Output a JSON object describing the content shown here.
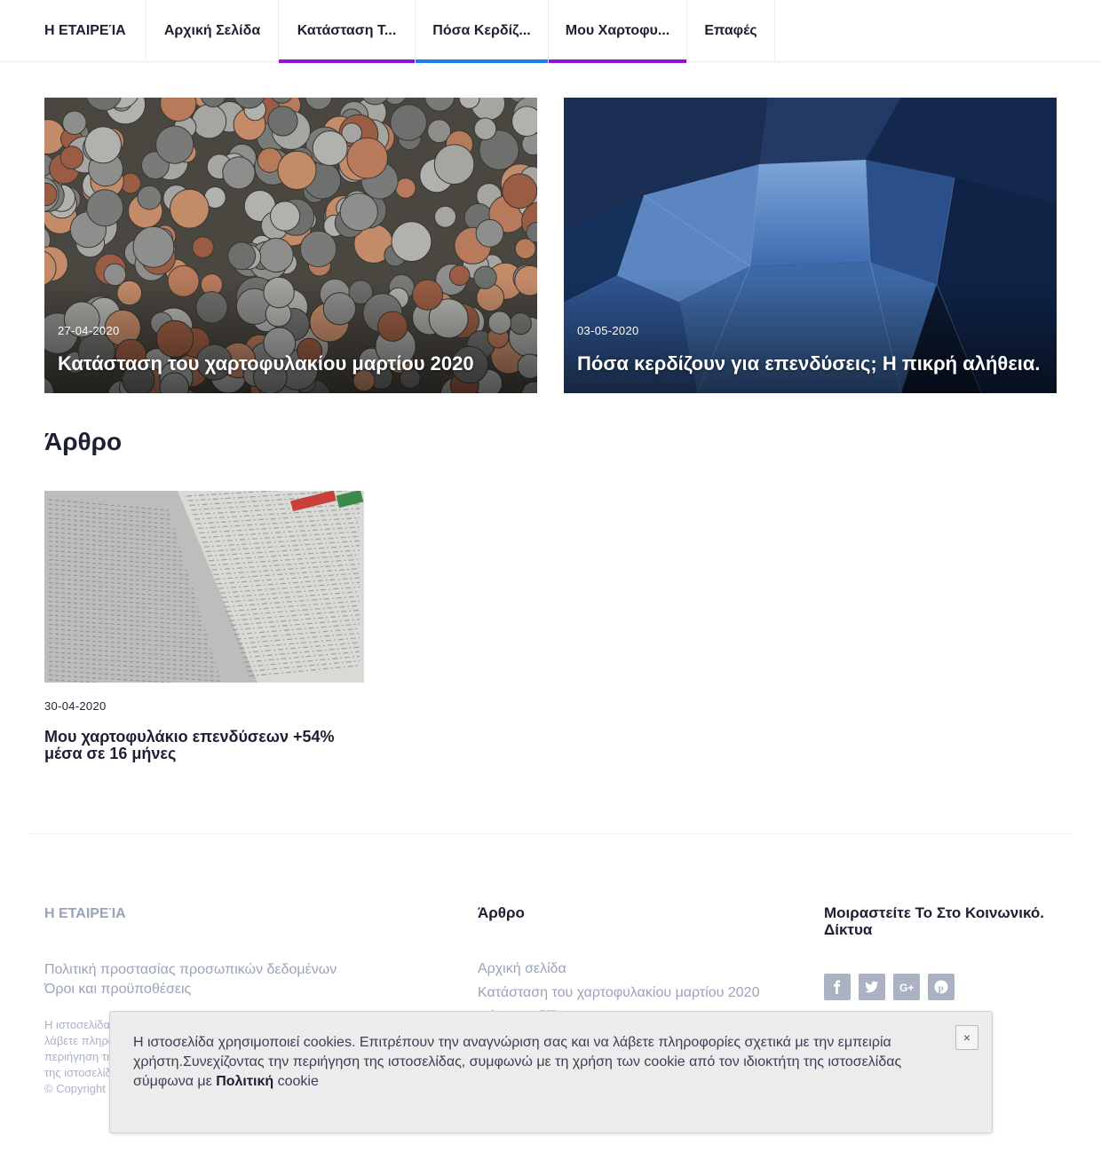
{
  "nav": {
    "brand": "Η ΕΤΑΙΡΕΊΑ",
    "items": [
      {
        "label": "Αρχική Σελίδα",
        "underline": ""
      },
      {
        "label": "Κατάσταση Τ...",
        "underline": "#8a14d8"
      },
      {
        "label": "Πόσα Κερδίζ...",
        "underline": "#1a7ee6"
      },
      {
        "label": "Μου Χαρτοφυ...",
        "underline": "#8a14d8"
      },
      {
        "label": "Επαφές",
        "underline": ""
      }
    ]
  },
  "featured": [
    {
      "date": "27-04-2020",
      "title": "Κατάσταση του χαρτοφυλακίου μαρτίου 2020",
      "image": "coins-photo"
    },
    {
      "date": "03-05-2020",
      "title": "Πόσα κερδίζουν για επενδύσεις; Η πικρή αλήθεια.",
      "image": "glass-building-photo"
    }
  ],
  "section": {
    "title": "Άρθρο",
    "articles": [
      {
        "date": "30-04-2020",
        "title": "Μου χαρτοφυλάκιο επενδύσεων +54% μέσα σε 16 μήνες",
        "image": "financial-newspaper-photo"
      }
    ]
  },
  "footer": {
    "brand": "Η ΕΤΑΙΡΕΊΑ",
    "links": [
      "Πολιτική προστασίας προσωπικών δεδομένων",
      "Όροι και προϋποθέσεις"
    ],
    "small_lines": [
      "Η ιστοσελίδα",
      "λάβετε πληρο",
      "περιήγηση τη",
      "της ιστοσελίδ",
      "© Copyright"
    ],
    "col2_title": "Άρθρο",
    "col2_links": [
      "Αρχική σελίδα",
      "Κατάσταση του χαρτοφυλακίου μαρτίου 2020",
      "Πόσα κερδίζ"
    ],
    "col3_title": "Μοιραστείτε Το Στο Κοινωνικό. Δίκτυα",
    "social": [
      "facebook-icon",
      "twitter-icon",
      "google-plus-icon",
      "pinterest-icon"
    ]
  },
  "cookie": {
    "text_1": "Η ιστοσελίδα χρησιμοποιεί cookies. Επιτρέπουν την αναγνώριση σας και να λάβετε πληροφορίες σχετικά με την εμπειρία χρήστη.Συνεχίζοντας την περιήγηση της ιστοσελίδας, συμφωνώ με τη χρήση των cookie από τον ιδιοκτήτη της ιστοσελίδας σύμφωνα με ",
    "link": "Πολιτική",
    "text_2": " cookie",
    "close": "×"
  },
  "colors": {
    "text": "#1d2033",
    "muted": "#9aa3b8",
    "accent_purple": "#8a14d8",
    "accent_blue": "#1a7ee6"
  }
}
